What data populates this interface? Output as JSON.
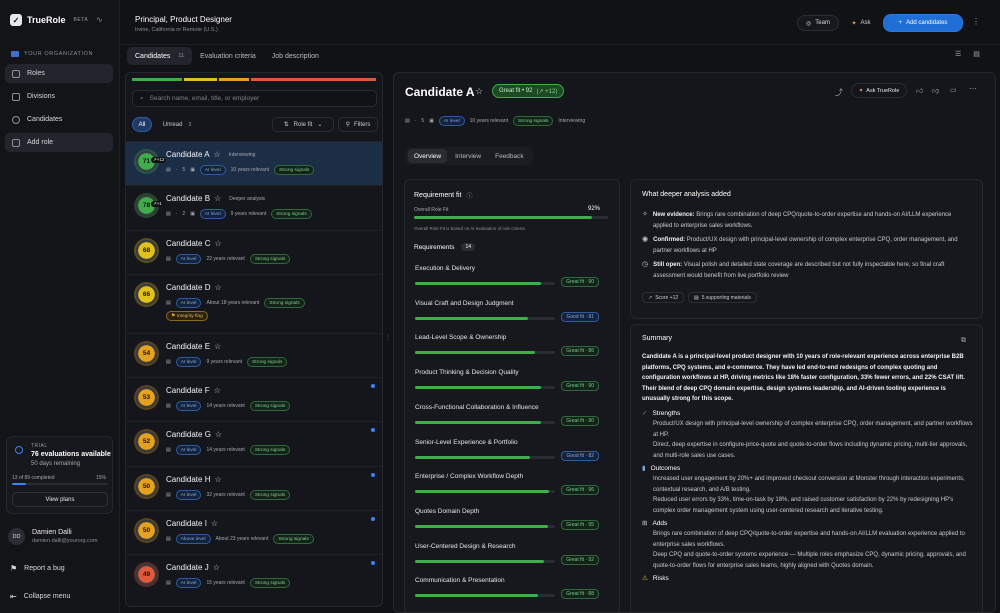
{
  "app": {
    "name": "TrueRole",
    "badge": "BETA"
  },
  "sidebar": {
    "org_label": "YOUR ORGANIZATION",
    "items": [
      {
        "label": "Roles"
      },
      {
        "label": "Divisions"
      },
      {
        "label": "Candidates"
      },
      {
        "label": "Add role"
      }
    ],
    "trial": {
      "label": "TRIAL",
      "available": "76 evaluations available",
      "remaining": "50 days remaining",
      "completed": "13 of 89 completed",
      "percent": "15%",
      "progress": 0.15,
      "button": "View plans"
    },
    "user": {
      "initials": "DD",
      "name": "Damien Dalli",
      "email": "damien.dalli@yourorg.com"
    },
    "report": "Report a bug",
    "collapse": "Collapse menu"
  },
  "header": {
    "title": "Principal, Product Designer",
    "subtitle": "Irvine, California or Remote (U.S.)",
    "team": "Team",
    "ask": "Ask",
    "add": "Add candidates"
  },
  "page_tabs": [
    {
      "label": "Candidates",
      "count": "11"
    },
    {
      "label": "Evaluation criteria"
    },
    {
      "label": "Job description"
    }
  ],
  "list": {
    "search_placeholder": "Search name, email, title, or employer",
    "filters": {
      "all": "All",
      "unread": "Unread",
      "unread_count": "3",
      "role_fit": "Role fit",
      "filters": "Filters"
    },
    "candidates": [
      {
        "name": "Candidate A",
        "score": "71",
        "delta": "+12",
        "status": "Interviewing",
        "files": "5",
        "ai": "AI level",
        "years": "10 years relevant",
        "signal": "Strong signals",
        "color": "#3fae4a"
      },
      {
        "name": "Candidate B",
        "score": "78",
        "delta": "+1",
        "status": "Deeper analysis",
        "files": "2",
        "ai": "AI level",
        "years": "9 years relevant",
        "signal": "Strong signals",
        "color": "#3fae4a"
      },
      {
        "name": "Candidate C",
        "score": "68",
        "ai": "AI level",
        "years": "22 years relevant",
        "signal": "Strong signals",
        "color": "#e3c11d"
      },
      {
        "name": "Candidate D",
        "score": "66",
        "ai": "AI level",
        "years": "About 18 years relevant",
        "signal": "Strong signals",
        "flag": "Integrity flag",
        "color": "#e3c11d"
      },
      {
        "name": "Candidate E",
        "score": "54",
        "ai": "AI level",
        "years": "9 years relevant",
        "signal": "Strong signals",
        "color": "#e6a21f"
      },
      {
        "name": "Candidate F",
        "score": "53",
        "ai": "AI level",
        "years": "14 years relevant",
        "signal": "Strong signals",
        "color": "#e6a21f"
      },
      {
        "name": "Candidate G",
        "score": "52",
        "ai": "AI level",
        "years": "14 years relevant",
        "signal": "Strong signals",
        "color": "#e6a21f"
      },
      {
        "name": "Candidate H",
        "score": "50",
        "ai": "AI level",
        "years": "32 years relevant",
        "signal": "Strong signals",
        "color": "#e6a21f"
      },
      {
        "name": "Candidate I",
        "score": "50",
        "ai": "Above level",
        "years": "About 23 years relevant",
        "signal": "Strong signals",
        "color": "#e6a21f"
      },
      {
        "name": "Candidate J",
        "score": "49",
        "ai": "AI level",
        "years": "15 years relevant",
        "signal": "Strong signals",
        "color": "#e05a3a"
      }
    ]
  },
  "detail": {
    "name": "Candidate A",
    "fit_badge": "Great fit • 92",
    "delta": "+12",
    "ask": "Ask TrueRole",
    "files": "5",
    "ai": "AI level",
    "years": "10 years relevant",
    "signal": "Strong signals",
    "status": "Interviewing",
    "tabs": [
      "Overview",
      "Interview",
      "Feedback"
    ],
    "requirement_fit": {
      "title": "Requirement fit",
      "overall_label": "Overall Role Fit",
      "overall_value": "92%",
      "overall": 0.92,
      "note": "Overall Role Fit is based on AI evaluation of role criteria.",
      "req_label": "Requirements",
      "req_count": "14",
      "items": [
        {
          "name": "Execution & Delivery",
          "fit": "Great fit · 90",
          "v": 0.9,
          "great": true
        },
        {
          "name": "Visual Craft and Design Judgment",
          "fit": "Good fit · 81",
          "v": 0.81,
          "great": false
        },
        {
          "name": "Lead-Level Scope & Ownership",
          "fit": "Great fit · 86",
          "v": 0.86,
          "great": true
        },
        {
          "name": "Product Thinking & Decision Quality",
          "fit": "Great fit · 90",
          "v": 0.9,
          "great": true
        },
        {
          "name": "Cross-Functional Collaboration & Influence",
          "fit": "Great fit · 90",
          "v": 0.9,
          "great": true
        },
        {
          "name": "Senior-Level Experience & Portfolio",
          "fit": "Good fit · 82",
          "v": 0.82,
          "great": false
        },
        {
          "name": "Enterprise / Complex Workflow Depth",
          "fit": "Great fit · 96",
          "v": 0.96,
          "great": true
        },
        {
          "name": "Quotes Domain Depth",
          "fit": "Great fit · 95",
          "v": 0.95,
          "great": true
        },
        {
          "name": "User-Centered Design & Research",
          "fit": "Great fit · 92",
          "v": 0.92,
          "great": true
        },
        {
          "name": "Communication & Presentation",
          "fit": "Great fit · 88",
          "v": 0.88,
          "great": true
        }
      ]
    },
    "deeper": {
      "title": "What deeper analysis added",
      "items": [
        {
          "label": "New evidence:",
          "text": "Brings rare combination of deep CPQ/quote-to-order expertise and hands-on AI/LLM experience applied to enterprise sales workflows."
        },
        {
          "label": "Confirmed:",
          "text": "Product/UX design with principal-level ownership of complex enterprise CPQ, order management, and partner workflows at HP"
        },
        {
          "label": "Still open:",
          "text": "Visual polish and detailed state coverage are described but not fully inspectable here, so final craft assessment would benefit from live portfolio review"
        }
      ],
      "score": "Score +12",
      "materials": "5 supporting materials"
    },
    "summary": {
      "title": "Summary",
      "lead": "Candidate A is a principal-level product designer with 10 years of role-relevant experience across enterprise B2B platforms, CPQ systems, and e-commerce. They have led end-to-end redesigns of complex quoting and configuration workflows at HP, driving metrics like 18% faster configuration, 33% fewer errors, and 22% CSAT lift. Their blend of deep CPQ domain expertise, design systems leadership, and AI-driven tooling experience is unusually strong for this scope.",
      "strengths_title": "Strengths",
      "strengths": [
        "Product/UX design with principal-level ownership of complex enterprise CPQ, order management, and partner workflows at HP.",
        "Direct, deep expertise in configure-price-quote and quote-to-order flows including dynamic pricing, multi-tier approvals, and multi-role sales use cases."
      ],
      "outcomes_title": "Outcomes",
      "outcomes": [
        "Increased user engagement by 20%+ and improved checkout conversion at Monster through interaction experiments, contextual research, and A/B testing.",
        "Reduced user errors by 33%, time-on-task by 18%, and raised customer satisfaction by 22% by redesigning HP's complex order management system using user-centered research and iterative testing."
      ],
      "adds_title": "Adds",
      "adds": [
        "Brings rare combination of deep CPQ/quote-to-order expertise and hands-on AI/LLM evaluation experience applied to enterprise sales workflows.",
        "Deep CPQ and quote-to-order systems experience — Multiple roles emphasize CPQ, dynamic pricing, approvals, and quote-to-order flows for enterprise sales teams, highly aligned with Quotes domain."
      ],
      "risks_title": "Risks"
    }
  }
}
